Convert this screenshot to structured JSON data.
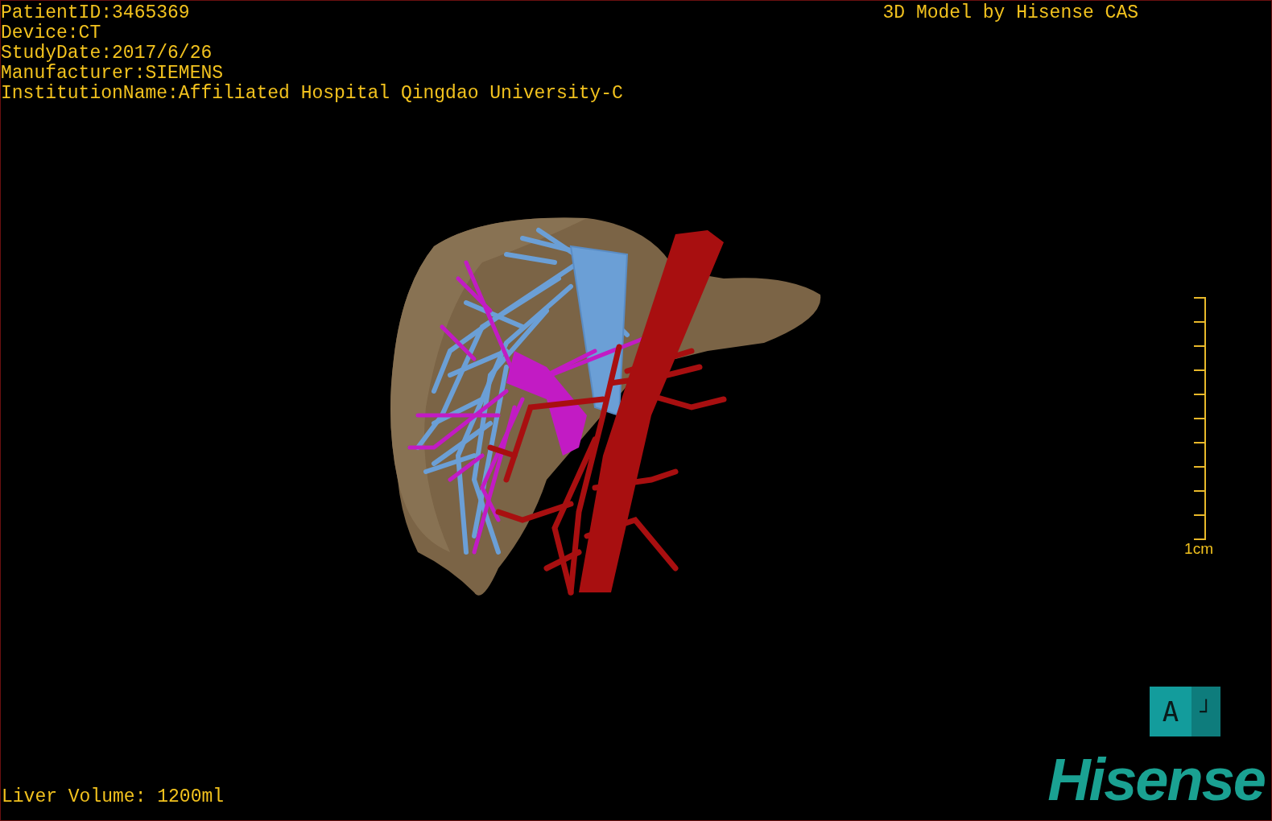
{
  "study_info": [
    "PatientID:3465369",
    "Device:CT",
    "StudyDate:2017/6/26",
    "Manufacturer:SIEMENS",
    "InstitutionName:Affiliated Hospital Qingdao University-C"
  ],
  "title": "3D Model by Hisense CAS",
  "scale_bar": {
    "label": "1cm"
  },
  "orientation_cube": {
    "front": "A",
    "side": "┘"
  },
  "liver_volume": "Liver Volume: 1200ml",
  "logo": "Hisense"
}
